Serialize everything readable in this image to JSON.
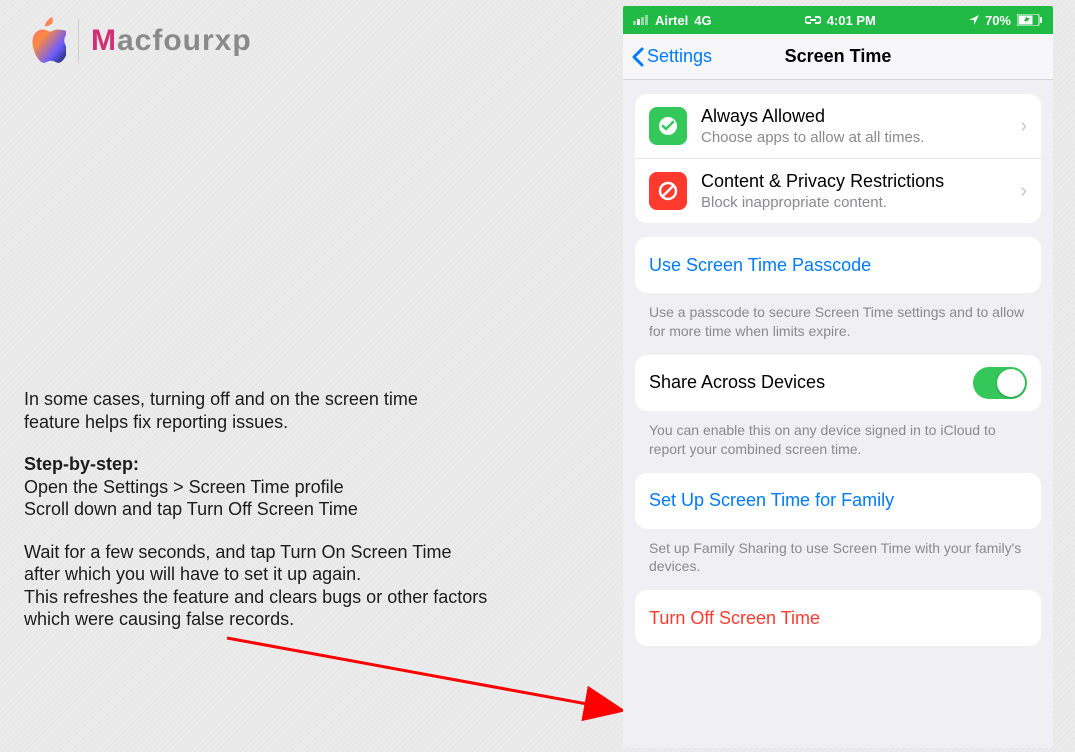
{
  "brand": {
    "m": "M",
    "rest": "acfourxp"
  },
  "copy": {
    "p1a": "In some cases, turning off and on the screen time",
    "p1b": "feature helps fix reporting issues.",
    "step_head": "Step-by-step:",
    "p2a": "Open the Settings > Screen Time profile",
    "p2b": "Scroll down and tap Turn Off Screen Time",
    "p3a": "Wait for a few seconds, and tap Turn On Screen Time",
    "p3b": "after which you will have to set it up again.",
    "p3c": "This refreshes the feature and clears bugs or other factors",
    "p3d": "which were causing false records."
  },
  "phone": {
    "status": {
      "carrier": "Airtel",
      "network": "4G",
      "time": "4:01 PM",
      "battery": "70%"
    },
    "nav": {
      "back": "Settings",
      "title": "Screen Time"
    },
    "rows": {
      "always": {
        "title": "Always Allowed",
        "sub": "Choose apps to allow at all times."
      },
      "content": {
        "title": "Content & Privacy Restrictions",
        "sub": "Block inappropriate content."
      },
      "passcode": {
        "title": "Use Screen Time Passcode"
      },
      "share": {
        "title": "Share Across Devices"
      },
      "family": {
        "title": "Set Up Screen Time for Family"
      },
      "off": {
        "title": "Turn Off Screen Time"
      }
    },
    "notes": {
      "passcode": "Use a passcode to secure Screen Time settings and to allow for more time when limits expire.",
      "share": "You can enable this on any device signed in to iCloud to report your combined screen time.",
      "family": "Set up Family Sharing to use Screen Time with your family's devices."
    }
  },
  "colors": {
    "accent_blue": "#007aff",
    "status_green": "#21ba45",
    "toggle_green": "#34c759",
    "danger_red": "#ff3b30"
  }
}
